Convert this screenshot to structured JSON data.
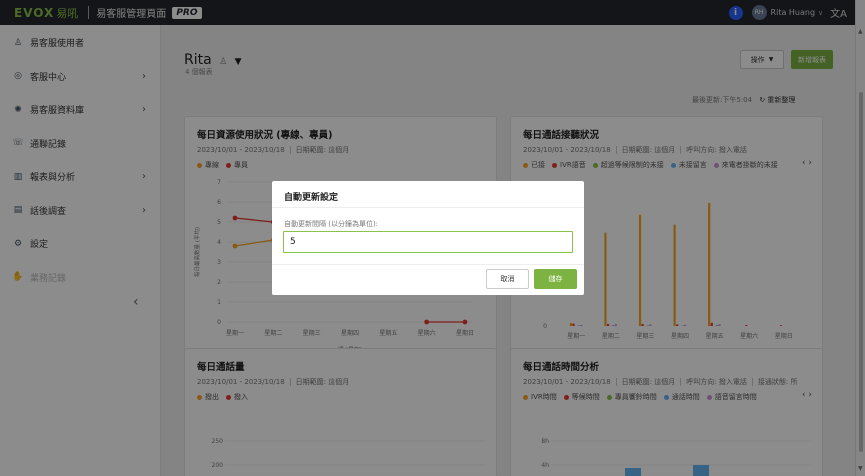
{
  "topbar": {
    "logo_text": "EVOX",
    "logo_cn": "易吼",
    "app_title": "易客服管理頁面",
    "badge": "PRO",
    "info_icon": "i",
    "avatar_initials": "RH",
    "user_name": "Rita Huang",
    "lang_icon": "文A"
  },
  "sidebar": {
    "items": [
      {
        "label": "易客服使用者",
        "icon": "user-icon"
      },
      {
        "label": "客服中心",
        "icon": "headset-icon",
        "arrow": "›"
      },
      {
        "label": "易客服資料庫",
        "icon": "lightbulb-icon",
        "arrow": "›"
      },
      {
        "label": "通聯記錄",
        "icon": "phone-icon"
      },
      {
        "label": "報表與分析",
        "icon": "bar-chart-icon",
        "arrow": "›"
      },
      {
        "label": "話後調查",
        "icon": "clipboard-icon",
        "arrow": "›"
      },
      {
        "label": "設定",
        "icon": "gear-icon"
      },
      {
        "label": "業務記錄",
        "icon": "handshake-icon"
      }
    ],
    "collapse": "‹"
  },
  "header": {
    "name": "Rita",
    "report_count": "4 個報表",
    "ops_label": "操作",
    "new_report_label": "新增報表",
    "updated_text": "最後更新:下午5:04",
    "refresh_label": "重新整理"
  },
  "cards": [
    {
      "title": "每日資源使用狀況 (專線、專員)",
      "date_range": "2023/10/01 - 2023/10/18",
      "range_type": "日期範圍: 這個月",
      "legend": [
        {
          "name": "專線",
          "color": "#f5a623"
        },
        {
          "name": "專員",
          "color": "#e53935"
        }
      ],
      "ylabel": "每日最高數量 (平均)",
      "xlabel": "週 (星期)"
    },
    {
      "title": "每日通話接聽狀況",
      "date_range": "2023/10/01 - 2023/10/18",
      "range_type": "日期範圍: 這個月",
      "direction": "呼叫方向: 撥入電話",
      "legend": [
        {
          "name": "已接",
          "color": "#f5a623"
        },
        {
          "name": "IVR語音",
          "color": "#e53935"
        },
        {
          "name": "超過等候限制的未接",
          "color": "#8bc34a"
        },
        {
          "name": "未接留言",
          "color": "#64b5f6"
        },
        {
          "name": "來電者掛斷的未接",
          "color": "#ce93d8"
        }
      ],
      "xlabel": "週 (星期)"
    },
    {
      "title": "每日通話量",
      "date_range": "2023/10/01 - 2023/10/18",
      "range_type": "日期範圍: 這個月",
      "legend": [
        {
          "name": "撥出",
          "color": "#f5a623"
        },
        {
          "name": "撥入",
          "color": "#e53935"
        }
      ]
    },
    {
      "title": "每日通話時間分析",
      "date_range": "2023/10/01 - 2023/10/18",
      "range_type": "日期範圍: 這個月",
      "direction": "呼叫方向: 撥入電話",
      "extra": "接通狀態: 所",
      "legend": [
        {
          "name": "IVR時間",
          "color": "#f5a623"
        },
        {
          "name": "等候時間",
          "color": "#e53935"
        },
        {
          "name": "專員響鈴時間",
          "color": "#8bc34a"
        },
        {
          "name": "通話時間",
          "color": "#64b5f6"
        },
        {
          "name": "語音留言時間",
          "color": "#ce93d8"
        }
      ]
    }
  ],
  "chart_data": [
    {
      "type": "line",
      "title": "每日資源使用狀況 (專線、專員)",
      "xlabel": "週 (星期)",
      "ylabel": "每日最高數量 (平均)",
      "categories": [
        "星期一",
        "星期二",
        "星期三",
        "星期四",
        "星期五",
        "星期六",
        "星期日"
      ],
      "ylim": [
        0,
        7
      ],
      "yticks": [
        "0",
        "1",
        "2",
        "3",
        "4",
        "5",
        "6",
        "7"
      ],
      "series": [
        {
          "name": "專線",
          "color": "#f5a623",
          "values": [
            3.8,
            4.1,
            null,
            null,
            null,
            null,
            null
          ]
        },
        {
          "name": "專員",
          "color": "#e53935",
          "values": [
            5.2,
            5.0,
            null,
            null,
            null,
            0,
            0
          ]
        }
      ]
    },
    {
      "type": "bar",
      "title": "每日通話接聽狀況",
      "xlabel": "週 (星期)",
      "categories": [
        "星期一",
        "星期二",
        "星期三",
        "星期四",
        "星期五",
        "星期六",
        "星期日"
      ],
      "ytick_visible": "0",
      "series": [
        {
          "name": "已接",
          "color": "#f5a623",
          "values": [
            1.5,
            47,
            56,
            51,
            62,
            0,
            0
          ]
        },
        {
          "name": "IVR語音",
          "color": "#e53935",
          "values": [
            1.2,
            1.0,
            1.0,
            0.8,
            1.6,
            0.5,
            0.4
          ]
        },
        {
          "name": "超過等候限制的未接",
          "color": "#8bc34a",
          "values": [
            0,
            0,
            0,
            0,
            0,
            0,
            0
          ]
        },
        {
          "name": "未接留言",
          "color": "#64b5f6",
          "values": [
            0.3,
            0.4,
            0.3,
            0.2,
            0.5,
            0,
            0
          ]
        },
        {
          "name": "來電者掛斷的未接",
          "color": "#ce93d8",
          "values": [
            0.5,
            0.9,
            0.8,
            0.6,
            0.9,
            0,
            0
          ]
        }
      ]
    },
    {
      "type": "line",
      "title": "每日通話量",
      "yticks": [
        "250",
        "200"
      ],
      "series": [
        {
          "name": "撥出",
          "color": "#f5a623",
          "values": []
        },
        {
          "name": "撥入",
          "color": "#e53935",
          "values": []
        }
      ]
    },
    {
      "type": "bar",
      "title": "每日通話時間分析",
      "yticks": [
        "8h",
        "4h"
      ],
      "series": [
        {
          "name": "通話時間",
          "color": "#64b5f6",
          "values": [
            1.5,
            3.5,
            0,
            4.0,
            0,
            0,
            0
          ]
        }
      ]
    }
  ],
  "modal": {
    "title": "自動更新設定",
    "label": "自動更新間隔 (以分鐘為單位):",
    "value": "5",
    "cancel_label": "取消",
    "save_label": "儲存"
  }
}
